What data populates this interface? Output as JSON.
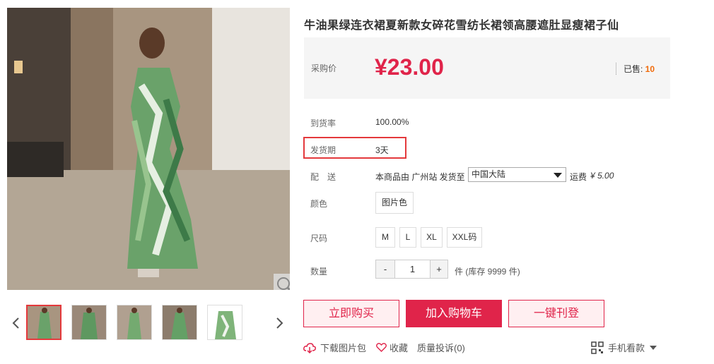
{
  "product": {
    "title": "牛油果绿连衣裙夏新款女碎花雪纺长裙领高腰遮肚显瘦裙子仙"
  },
  "price_box": {
    "label": "采购价",
    "price": "¥23.00",
    "sold_label": "已售:",
    "sold_count": "10"
  },
  "details": {
    "arrival_label": "到货率",
    "arrival_value": "100.00%",
    "ship_label": "发货期",
    "ship_value": "3天",
    "delivery_label": "配　送",
    "delivery_text": "本商品由 广州站 发货至",
    "destination": "中国大陆",
    "fee_label": "运费",
    "fee_value": "¥ 5.00"
  },
  "color": {
    "label": "颜色",
    "options": [
      "图片色"
    ]
  },
  "size": {
    "label": "尺码",
    "options": [
      "M",
      "L",
      "XL",
      "XXL码"
    ]
  },
  "quantity": {
    "label": "数量",
    "minus": "-",
    "value": "1",
    "plus": "+",
    "stock_text": "件 (库存 9999 件)"
  },
  "actions": {
    "buy_now": "立即购买",
    "add_cart": "加入购物车",
    "one_click": "一键刊登"
  },
  "links": {
    "download": "下载图片包",
    "favorite": "收藏",
    "complaint": "质量投诉(0)",
    "mobile": "手机看款"
  },
  "colors": {
    "accent": "#e0244a",
    "sold_count": "#f16b0b",
    "highlight_border": "#e4393c"
  }
}
